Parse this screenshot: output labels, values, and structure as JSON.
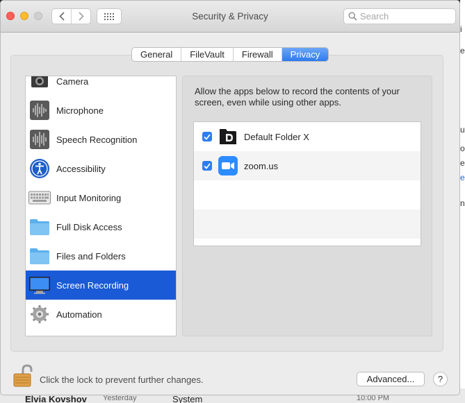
{
  "window": {
    "title": "Security & Privacy"
  },
  "search": {
    "placeholder": "Search",
    "value": ""
  },
  "tabs": [
    {
      "label": "General",
      "active": false
    },
    {
      "label": "FileVault",
      "active": false
    },
    {
      "label": "Firewall",
      "active": false
    },
    {
      "label": "Privacy",
      "active": true
    }
  ],
  "sidebar": {
    "items": [
      {
        "label": "Camera",
        "icon": "camera-icon"
      },
      {
        "label": "Microphone",
        "icon": "microphone-icon"
      },
      {
        "label": "Speech Recognition",
        "icon": "speech-recognition-icon"
      },
      {
        "label": "Accessibility",
        "icon": "accessibility-icon"
      },
      {
        "label": "Input Monitoring",
        "icon": "keyboard-icon"
      },
      {
        "label": "Full Disk Access",
        "icon": "folder-icon"
      },
      {
        "label": "Files and Folders",
        "icon": "folder-icon"
      },
      {
        "label": "Screen Recording",
        "icon": "display-icon",
        "selected": true
      },
      {
        "label": "Automation",
        "icon": "gear-icon"
      }
    ]
  },
  "detail": {
    "description": "Allow the apps below to record the contents of your screen, even while using other apps.",
    "apps": [
      {
        "name": "Default Folder X",
        "checked": true,
        "icon": "default-folder-x-icon"
      },
      {
        "name": "zoom.us",
        "checked": true,
        "icon": "zoom-icon"
      }
    ]
  },
  "footer": {
    "lock_text": "Click the lock to prevent further changes.",
    "advanced_label": "Advanced...",
    "help_label": "?"
  },
  "background": {
    "right_letters": [
      "i",
      "e",
      "u",
      "o",
      "e",
      "e",
      "n"
    ],
    "bottom_fragments": [
      "Elvia Kovshov",
      "Yesterday",
      "System",
      "10:00 PM"
    ]
  },
  "colors": {
    "accent": "#1a5ad7",
    "tab_active": "#2e7bf0",
    "checkbox": "#2f7cf2",
    "zoom_blue": "#2d8cff"
  }
}
